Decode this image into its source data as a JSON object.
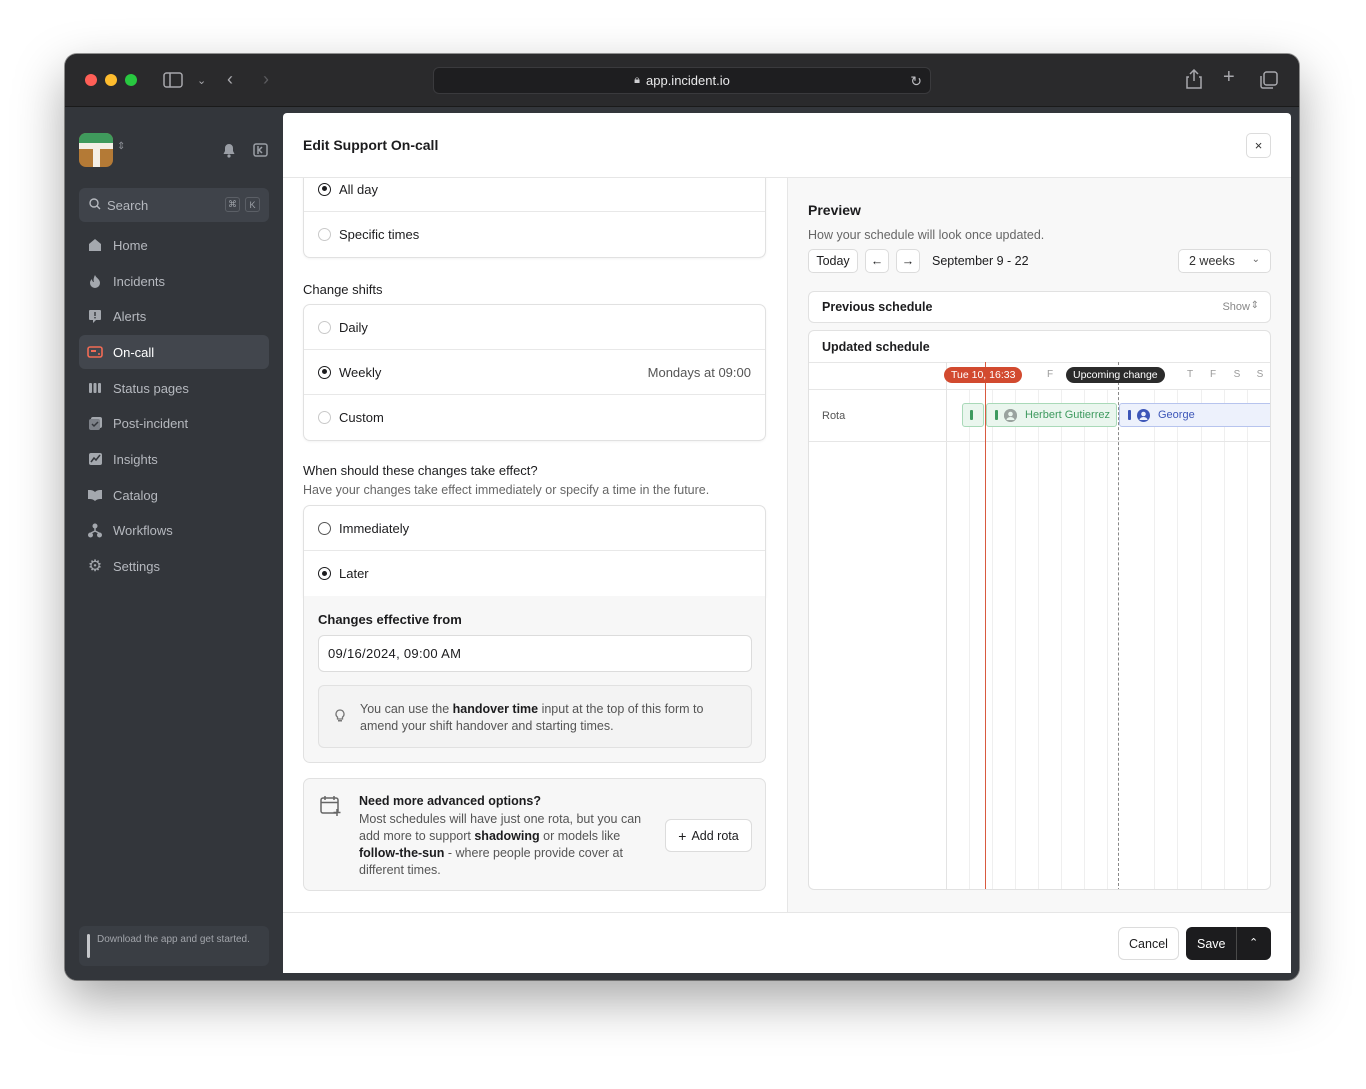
{
  "browser": {
    "url": "app.incident.io",
    "colors": {
      "close": "#ff5f57",
      "minimize": "#febc2e",
      "zoom": "#28c840"
    }
  },
  "sidebar": {
    "search_placeholder": "Search",
    "search_shortcut": [
      "⌘",
      "K"
    ],
    "items": [
      {
        "label": "Home",
        "icon": "home-icon"
      },
      {
        "label": "Incidents",
        "icon": "flame-icon"
      },
      {
        "label": "Alerts",
        "icon": "alert-icon"
      },
      {
        "label": "On-call",
        "icon": "pager-icon",
        "active": true
      },
      {
        "label": "Status pages",
        "icon": "status-bars-icon"
      },
      {
        "label": "Post-incident",
        "icon": "post-incident-icon"
      },
      {
        "label": "Insights",
        "icon": "chart-icon"
      },
      {
        "label": "Catalog",
        "icon": "book-icon"
      },
      {
        "label": "Workflows",
        "icon": "workflow-icon"
      },
      {
        "label": "Settings",
        "icon": "gear-icon"
      }
    ],
    "download_text": "Download the app and get started."
  },
  "modal": {
    "title": "Edit Support On-call",
    "close": "×",
    "handover": {
      "options": [
        {
          "label": "All day",
          "selected": true
        },
        {
          "label": "Specific times",
          "selected": false
        }
      ]
    },
    "change_shifts": {
      "label": "Change shifts",
      "options": [
        {
          "label": "Daily",
          "selected": false,
          "aside": ""
        },
        {
          "label": "Weekly",
          "selected": true,
          "aside": "Mondays at 09:00"
        },
        {
          "label": "Custom",
          "selected": false,
          "aside": ""
        }
      ]
    },
    "effect": {
      "question": "When should these changes take effect?",
      "hint": "Have your changes take effect immediately or specify a time in the future.",
      "options": [
        {
          "label": "Immediately",
          "selected": false
        },
        {
          "label": "Later",
          "selected": true
        }
      ],
      "effective_label": "Changes effective from",
      "effective_value": "09/16/2024, 09:00 AM",
      "tip_pre": "You can use the ",
      "tip_bold": "handover time",
      "tip_post": " input at the top of this form to amend your shift handover and starting times."
    },
    "advanced": {
      "title": "Need more advanced options?",
      "text_1": "Most schedules will have just one rota, but you can add more to support ",
      "bold_1": "shadowing",
      "text_2": " or models like ",
      "bold_2": "follow-the-sun",
      "text_3": " - where people provide cover at different times.",
      "button": "Add rota",
      "button_icon": "+"
    },
    "preview": {
      "title": "Preview",
      "subtitle": "How your schedule will look once updated.",
      "today": "Today",
      "prev_arrow": "←",
      "next_arrow": "→",
      "range": "September 9 - 22",
      "period": "2 weeks",
      "previous_schedule": "Previous schedule",
      "show": "Show",
      "updated_schedule": "Updated schedule",
      "days": [
        "F",
        "T",
        "F",
        "S",
        "S"
      ],
      "now_badge": "Tue 10, 16:33",
      "change_badge": "Upcoming change",
      "rota_label": "Rota",
      "shifts": [
        {
          "name": "Herbert Gutierrez",
          "color": "#3e9a5f",
          "bg": "#eaf6ee",
          "border": "#a9d9b8"
        },
        {
          "name": "George",
          "color": "#3d56b8",
          "bg": "#edf1fc",
          "border": "#b7c4ee"
        }
      ]
    },
    "footer": {
      "cancel": "Cancel",
      "save": "Save"
    }
  }
}
